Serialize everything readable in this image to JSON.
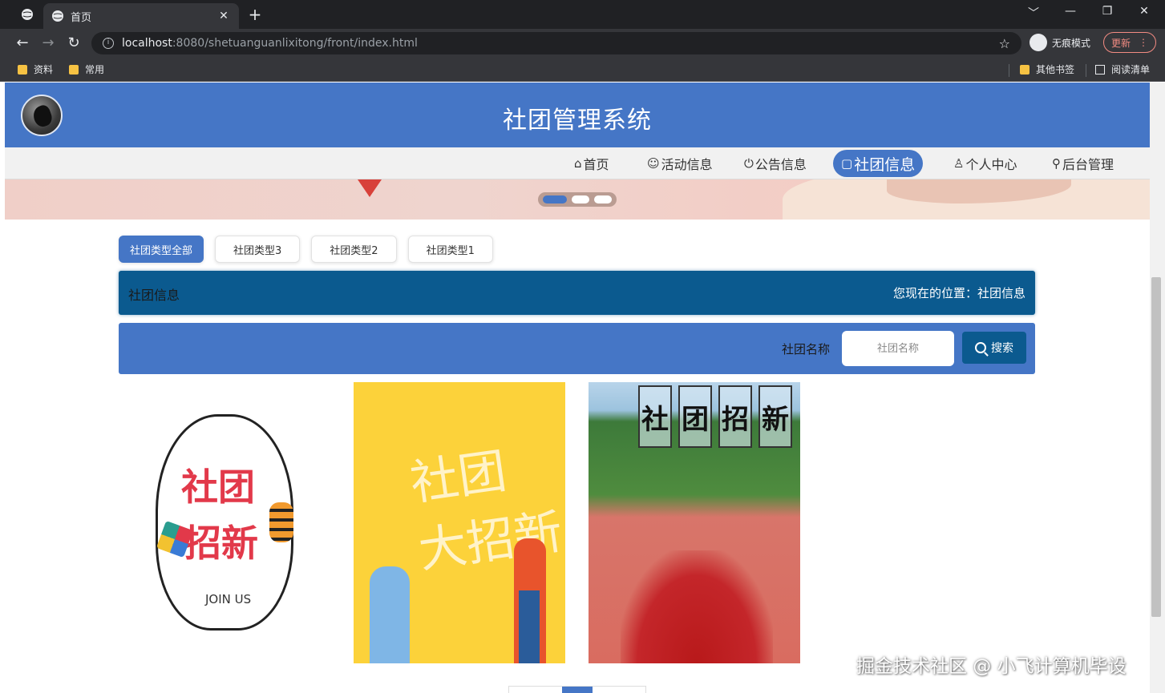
{
  "browser": {
    "tab_title": "首页",
    "url_host": "localhost",
    "url_path": ":8080/shetuanguanlixitong/front/index.html",
    "incognito_label": "无痕模式",
    "update_label": "更新",
    "new_tab_symbol": "+",
    "tab_close_symbol": "✕",
    "window_controls": [
      "﹀",
      "—",
      "❐",
      "✕"
    ],
    "bookmarks": [
      "资料",
      "常用"
    ],
    "bookmarks_right": [
      "其他书签",
      "阅读清单"
    ]
  },
  "site": {
    "title": "社团管理系统"
  },
  "nav": {
    "items": [
      {
        "icon": "⌂",
        "label": "首页"
      },
      {
        "icon": "☺",
        "label": "活动信息"
      },
      {
        "icon": "⏻",
        "label": "公告信息"
      },
      {
        "icon": "▢",
        "label": "社团信息"
      },
      {
        "icon": "♙",
        "label": "个人中心"
      },
      {
        "icon": "⚲",
        "label": "后台管理"
      }
    ],
    "active": "社团信息"
  },
  "type_tabs": [
    "社团类型全部",
    "社团类型3",
    "社团类型2",
    "社团类型1"
  ],
  "breadcrumb": {
    "title": "社团信息",
    "location": "您现在的位置：社团信息"
  },
  "search": {
    "label": "社团名称",
    "placeholder": "社团名称",
    "button": "搜索"
  },
  "cards": [
    {
      "text_a": "社",
      "text_b": "团",
      "text_c": "招",
      "text_d": "新",
      "text_e": "JOIN US"
    },
    {
      "text_a": "社团",
      "text_b": "大招新"
    },
    {
      "chars": [
        "社",
        "团",
        "招",
        "新"
      ]
    }
  ],
  "watermark": "掘金技术社区 @ 小飞计算机毕设",
  "colors": {
    "primary": "#4576c6",
    "dark_blue": "#0b5a8f"
  }
}
